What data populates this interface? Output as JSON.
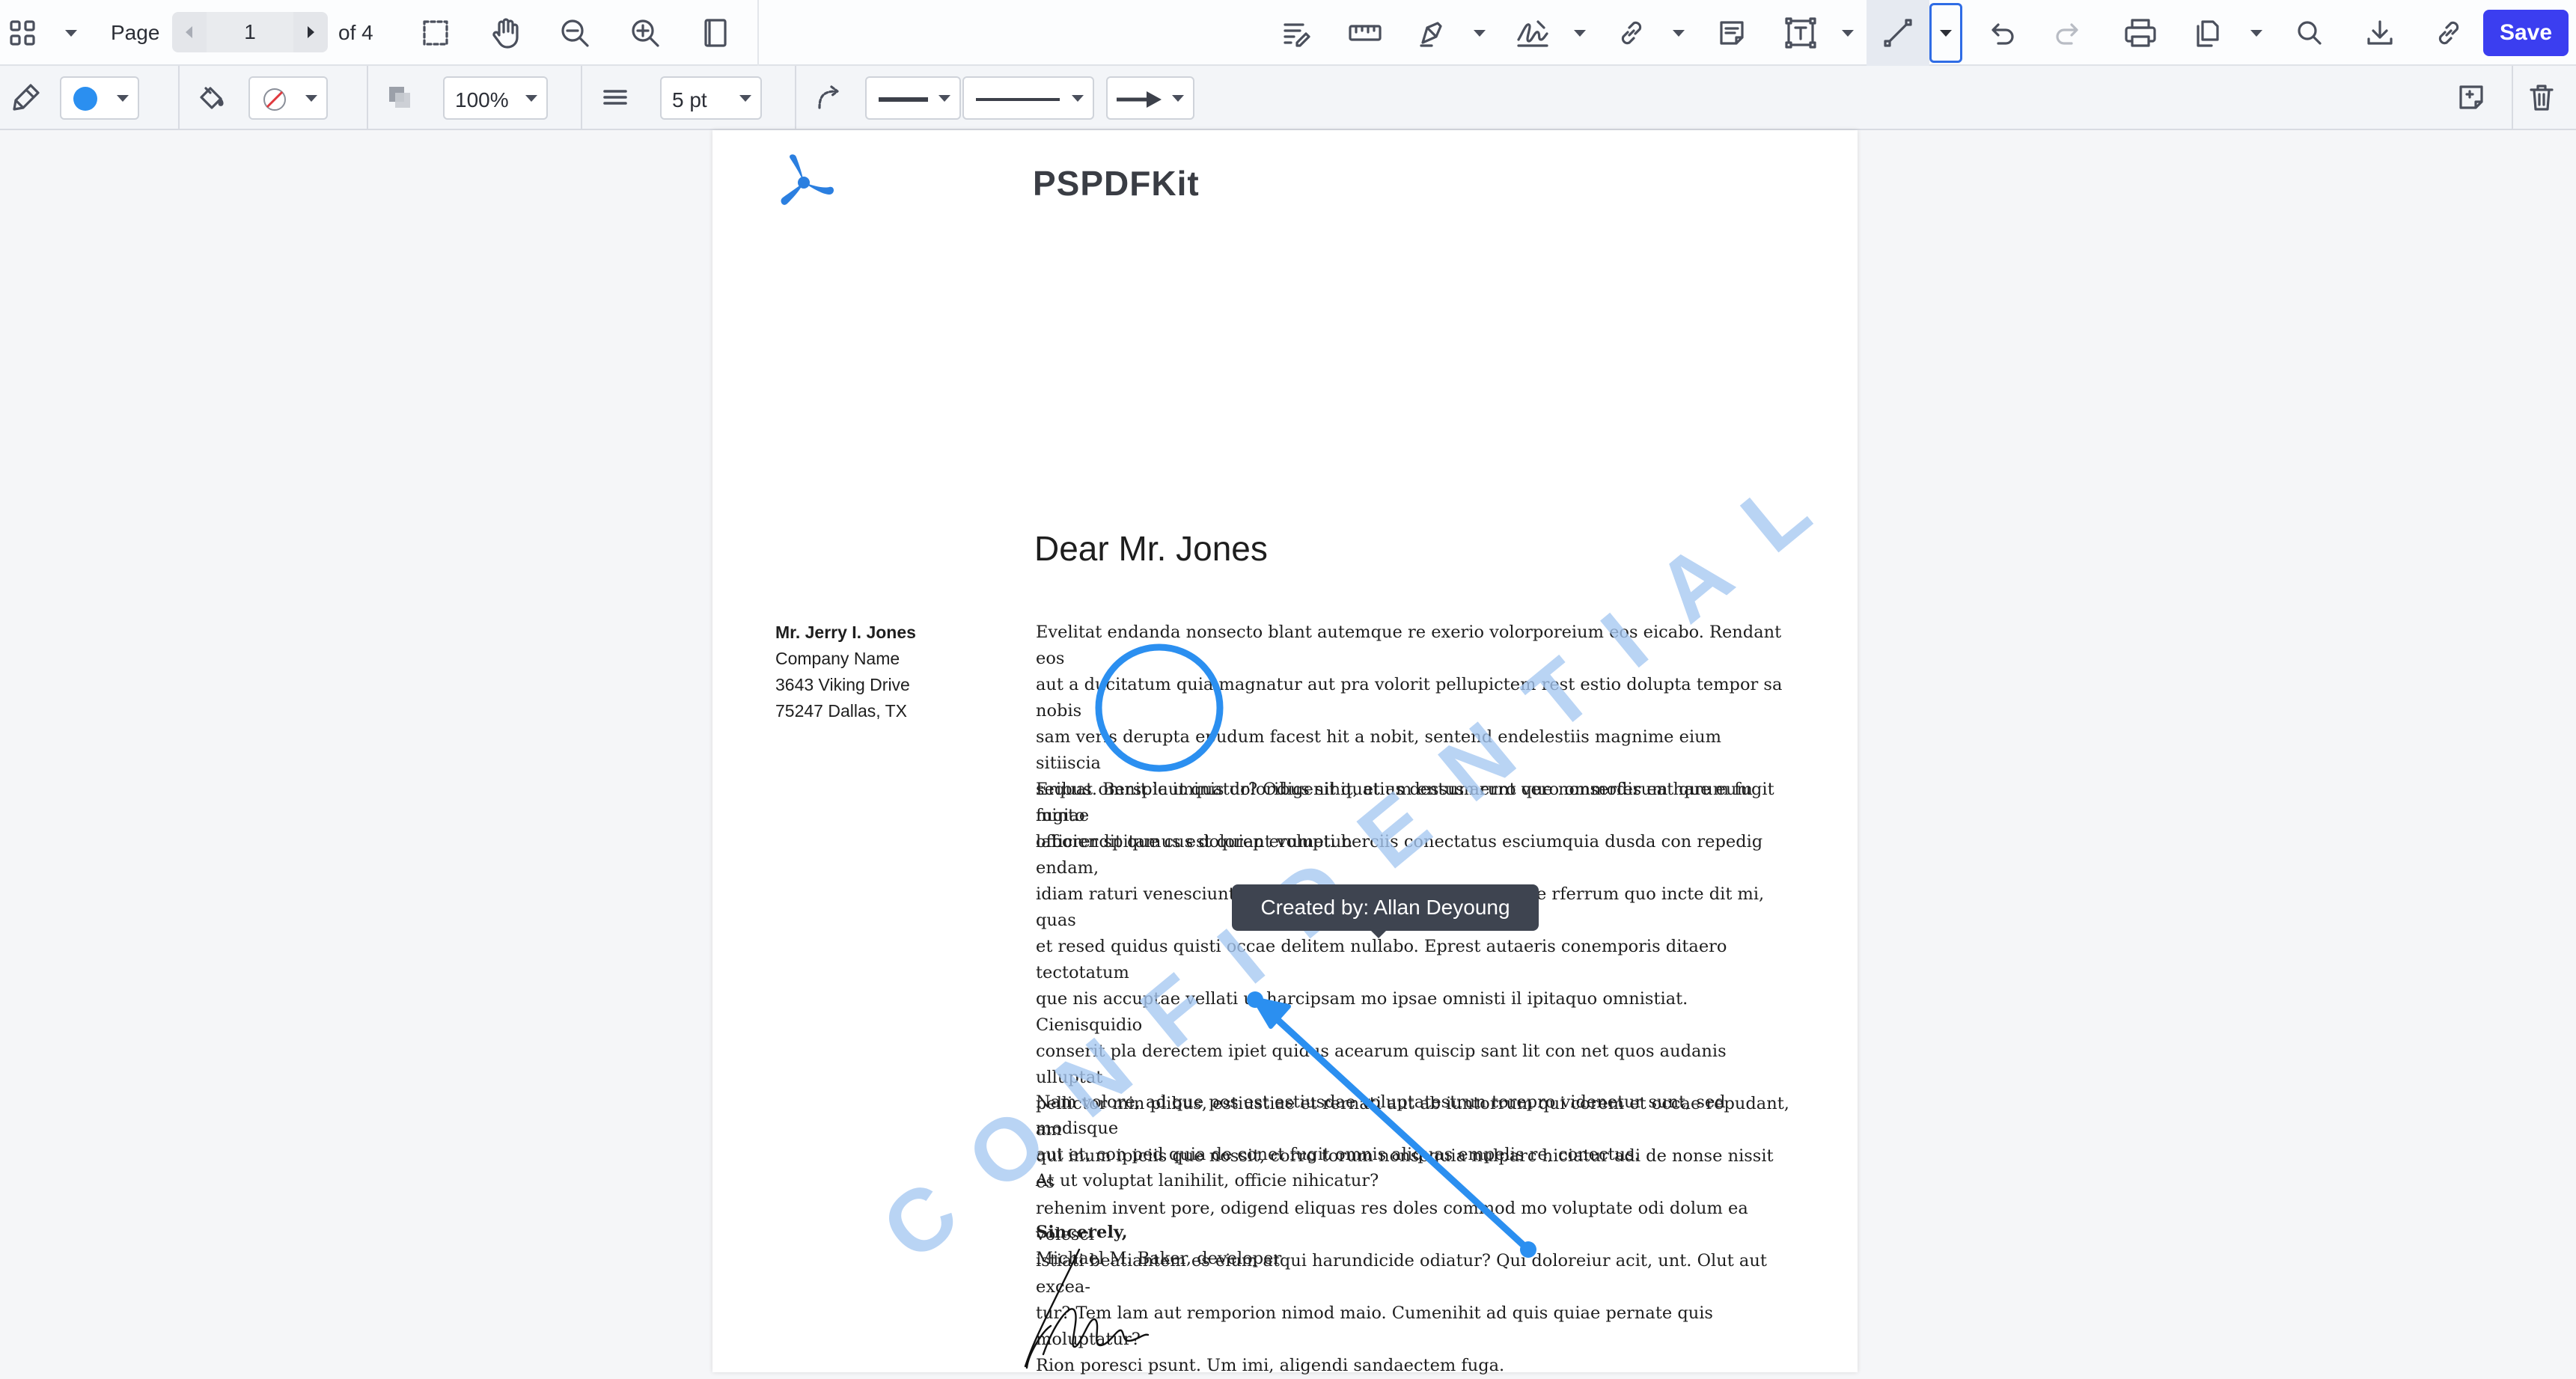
{
  "toolbar": {
    "page_label": "Page",
    "page_current": "1",
    "page_total_label": "of 4",
    "save_label": "Save",
    "icons": [
      "grid-icon",
      "chevron-down-icon",
      "prev-page-icon",
      "next-page-icon",
      "marquee-select-icon",
      "pan-hand-icon",
      "zoom-out-icon",
      "zoom-in-icon",
      "single-page-icon",
      "sign-list-icon",
      "measure-ruler-icon",
      "highlighter-icon",
      "signature-icon",
      "link-icon",
      "note-icon",
      "text-box-icon",
      "line-tool-icon",
      "undo-icon",
      "redo-icon",
      "print-icon",
      "document-editor-icon",
      "search-icon",
      "download-icon",
      "share-link-icon"
    ]
  },
  "annotation_toolbar": {
    "stroke_color": "#2b8ff0",
    "fill_color": "none",
    "opacity": "100%",
    "line_width": "5 pt",
    "icons": [
      "format-painter-icon",
      "fill-bucket-icon",
      "no-fill-icon",
      "opacity-icon",
      "line-width-icon",
      "curve-arrow-icon",
      "line-style-icon",
      "line-end-icon",
      "arrow-end-icon",
      "add-note-icon",
      "trash-icon"
    ]
  },
  "document": {
    "brand": "PSPDFKit",
    "salutation": "Dear Mr. Jones",
    "address": {
      "name": "Mr. Jerry I. Jones",
      "company": "Company Name",
      "street": "3643 Viking Drive",
      "city": "75247 Dallas, TX"
    },
    "paragraph1": [
      "Evelitat endanda nonsecto blant autemque re exerio volorporeium eos eicabo. Rendant eos",
      "aut a ducitatum quia magnatur aut pra volorit pellupictem rest estio dolupta tempor sa nobis",
      "sam veris derupta epudum facest hit a nobit, sentend endelestiis magnime eium sitiiscia",
      "sequat omnit laut quatur? Odigenihit, et as dessum erro que nonserferum harum fugit minto",
      "officiendit que cus dolorep erumetur."
    ],
    "paragraph2": [
      "Eribus. Berspic iminis doloribus sit quatium entus arunt vero ommodis eat que eum fugiae",
      "laborer spitamus est quiant volupti berciis conectatus esciumquia dusda con repedig endam,",
      "idiam raturi venesciuntin evelessitam volenim re lab ipiciae rferrum quo incte dit mi, quas",
      "et resed quidus quisti occae delitem nullabo. Eprest autaeris conemporis ditaero tectotatum",
      "que nis accuptae vellati ut harcipsam mo ipsae omnisti il ipitaquo omnistiat. Cienisquidio",
      "conserit pla derectem ipiet quidus acearum quiscip sant lit con net quos audanis ulluptat",
      "pellictor min plibus, estiustiae et rernati aut ab iuntorrum qui corem et occae repudant, am",
      "qui inum ipiciis que nossit, corro torum nonsequia nulparc hiciatur adi de nonse nissit es",
      "rehenim invent pore, odigend eliquas res doles commod mo voluptate odi dolum ea volesci",
      "istiati beatiantem es eium atqui harundicide odiatur? Qui doloreiur acit, unt. Olut aut excea-",
      "tur? Tem lam aut remporion nimod maio. Cumenihit ad quis quiae pernate quis moluptatur?",
      "Rion poresci psunt. Um imi, aligendi sandaectem fuga."
    ],
    "paragraph3": [
      "Nam volore, ad que pos est estiusdae voluptatestrun torepro videnetur sunt, sed modisque",
      "aut et, con ped quia de conet fugit omnis aliquas empelis re, conectus.",
      "At ut voluptat lanihilit, officie nihicatur?"
    ],
    "closing": "Sincerely,",
    "signer": "Michael M. Baker, developer",
    "watermark": "CONFIDENTIAL"
  },
  "tooltip": {
    "text": "Created by: Allan Deyoung"
  }
}
